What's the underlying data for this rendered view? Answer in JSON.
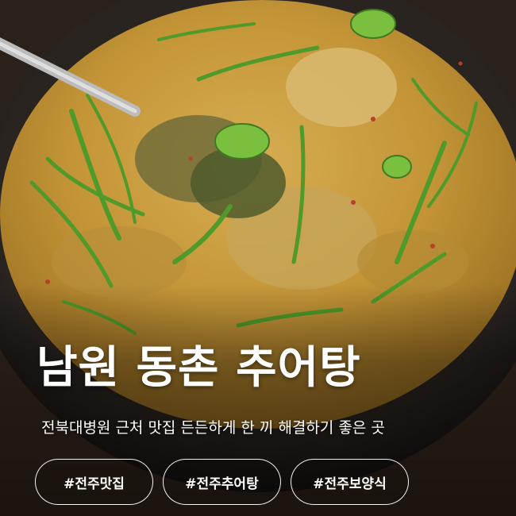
{
  "card": {
    "title": "남원 동촌 추어탕",
    "subtitle": "전북대병원 근처 맛집 든든하게 한 끼 해결하기 좋은 곳",
    "tags": [
      "#전주맛집",
      "#전주추어탕",
      "#전주보양식"
    ]
  },
  "colors": {
    "broth": "#c79a3c",
    "pot": "#1c1917",
    "scallion": "#4e8a2c",
    "text": "#ffffff"
  }
}
